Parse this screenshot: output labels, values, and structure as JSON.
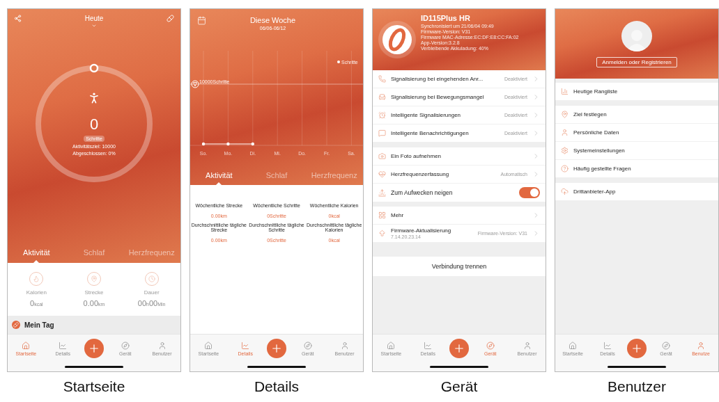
{
  "screens": [
    {
      "kind": "home",
      "caption": "Startseite",
      "title": "Heute",
      "ring": {
        "value": "0",
        "unit": "Schritte",
        "goal": "Aktivitätsziel: 10000",
        "completed": "Abgeschlossen: 0%"
      },
      "tabs": [
        {
          "label": "Aktivität",
          "selected": true
        },
        {
          "label": "Schlaf",
          "selected": false
        },
        {
          "label": "Herzfrequenz",
          "selected": false
        }
      ],
      "stats": [
        {
          "kind": "calories",
          "label": "Kalorien",
          "value": "0$_{kcal}$"
        },
        {
          "kind": "distance",
          "label": "Strecke",
          "value": "0.00$_{km}$"
        },
        {
          "kind": "duration",
          "label": "Dauer",
          "value": "00$_{h}$00$_{Min}$"
        }
      ],
      "banner": "Mein Tag",
      "nav": [
        {
          "kind": "home",
          "label": "Startseite",
          "selected": true
        },
        {
          "kind": "details",
          "label": "Details",
          "selected": false
        },
        {
          "kind": "device",
          "label": "Gerät",
          "selected": false
        },
        {
          "kind": "user",
          "label": "Benutzer",
          "selected": false
        }
      ]
    },
    {
      "kind": "details",
      "caption": "Details",
      "title": "Diese Woche",
      "subtitle": "06/06-06/12",
      "chart": {
        "legend": "Schritte",
        "goal_label": "10000Schritte",
        "days": [
          {
            "label": "So.",
            "has_point": true
          },
          {
            "label": "Mo.",
            "has_point": true
          },
          {
            "label": "Di.",
            "has_point": true
          },
          {
            "label": "Mi.",
            "has_point": false
          },
          {
            "label": "Do.",
            "has_point": false
          },
          {
            "label": "Fr.",
            "has_point": false
          },
          {
            "label": "Sa.",
            "has_point": false
          }
        ]
      },
      "tabs": [
        {
          "label": "Aktivität",
          "selected": true
        },
        {
          "label": "Schlaf",
          "selected": false
        },
        {
          "label": "Herzfrequenz",
          "selected": false
        }
      ],
      "stats": [
        {
          "label": "Wöchentliche Strecke",
          "value": "0.00km"
        },
        {
          "label": "Wöchentliche Schritte",
          "value": "0Schritte"
        },
        {
          "label": "Wöchentliche Kalorien",
          "value": "0kcal"
        },
        {
          "label": "Durchschnittliche tägliche Strecke",
          "value": "0.00km"
        },
        {
          "label": "Durchschnittliche tägliche Schritte",
          "value": "0Schritte"
        },
        {
          "label": "Durchschnittliche tägliche Kalorien",
          "value": "0kcal"
        }
      ],
      "nav": [
        {
          "kind": "home",
          "label": "Startseite",
          "selected": false
        },
        {
          "kind": "details",
          "label": "Details",
          "selected": true
        },
        {
          "kind": "device",
          "label": "Gerät",
          "selected": false
        },
        {
          "kind": "user",
          "label": "Benutzer",
          "selected": false
        }
      ]
    },
    {
      "kind": "device",
      "caption": "Gerät",
      "device": {
        "name": "ID115Plus HR",
        "info": [
          "Synchronisiert um 21/06/04 09:49",
          "Firmware-Version: V31",
          "Firmware MAC-Adresse:EC:DF:E8:CC:FA:02",
          "App-Version:3.2.8",
          "Verbleibende Akkuladung: 40%"
        ]
      },
      "groups": [
        {
          "rows": [
            {
              "kind": "link",
              "label": "Signalisierung bei eingehenden Anr...",
              "status": "Deaktiviert"
            },
            {
              "kind": "link",
              "label": "Signalisierung bei Bewegungsmangel",
              "status": "Deaktiviert"
            },
            {
              "kind": "link",
              "label": "Intelligente Signalisierungen",
              "status": "Deaktiviert"
            },
            {
              "kind": "link",
              "label": "Intelligente Benachrichtigungen",
              "status": "Deaktiviert"
            }
          ]
        },
        {
          "rows": [
            {
              "kind": "link",
              "label": "Ein Foto aufnehmen"
            },
            {
              "kind": "link",
              "label": "Herzfrequenzerfassung",
              "status": "Automatisch"
            },
            {
              "kind": "toggle",
              "label": "Zum Aufwecken neigen",
              "on": true
            }
          ]
        },
        {
          "rows": [
            {
              "kind": "link",
              "label": "Mehr"
            },
            {
              "kind": "link",
              "label": "Firmware-Aktualisierung",
              "sub": "7.14.20.23.14",
              "status": "Firmware-Version: V31"
            }
          ]
        }
      ],
      "disconnect": "Verbindung trennen",
      "nav": [
        {
          "kind": "home",
          "label": "Startseite",
          "selected": false
        },
        {
          "kind": "details",
          "label": "Details",
          "selected": false
        },
        {
          "kind": "device",
          "label": "Gerät",
          "selected": true
        },
        {
          "kind": "user",
          "label": "Benutzer",
          "selected": false
        }
      ]
    },
    {
      "kind": "user",
      "caption": "Benutzer",
      "login": "Anmelden oder Registrieren",
      "groups": [
        {
          "rows": [
            {
              "kind": "item",
              "label": "Heutige Rangliste"
            }
          ]
        },
        {
          "rows": [
            {
              "kind": "item",
              "label": "Ziel festlegen"
            },
            {
              "kind": "item",
              "label": "Persönliche Daten"
            },
            {
              "kind": "item",
              "label": "Systemeinstellungen"
            },
            {
              "kind": "item",
              "label": "Häufig gestellte Fragen"
            }
          ]
        },
        {
          "rows": [
            {
              "kind": "item",
              "label": "Drittanbieter-App"
            }
          ]
        }
      ],
      "nav": [
        {
          "kind": "home",
          "label": "Startseite",
          "selected": false
        },
        {
          "kind": "details",
          "label": "Details",
          "selected": false
        },
        {
          "kind": "device",
          "label": "Gerät",
          "selected": false
        },
        {
          "kind": "user",
          "label": "Benutze",
          "selected": true
        }
      ]
    }
  ]
}
